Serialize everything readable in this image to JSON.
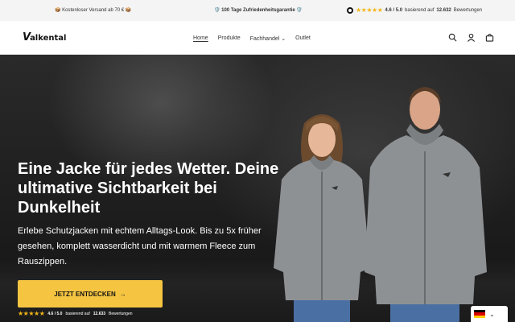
{
  "announcement": {
    "shipping": "📦 Kostenloser Versand ab 70 € 📦",
    "guarantee": "🛡️ 100 Tage Zufriedenheitsgarantie 🛡️",
    "rating_value": "4.6 / 5.0",
    "rating_text": "basierend auf",
    "rating_count": "12.632",
    "rating_suffix": "Bewertungen",
    "stars": "★★★★★"
  },
  "header": {
    "logo": "alkental",
    "logo_v": "V",
    "nav": [
      "Home",
      "Produkte",
      "Fachhandel ⌄",
      "Outlet"
    ],
    "icons": [
      "search-icon",
      "account-icon",
      "cart-icon"
    ]
  },
  "hero": {
    "headline": "Eine Jacke für jedes Wetter. Deine ultimative Sichtbarkeit bei Dunkelheit",
    "subtext": "Erlebe Schutzjacken mit echtem Alltags-Look. Bis zu 5x früher gesehen, komplett wasserdicht und mit warmem Fleece zum Rauszippen.",
    "cta_label": "JETZT ENTDECKEN",
    "cta_arrow": "→",
    "rating_stars": "★★★★★",
    "rating_value": "4.6 / 5.0",
    "rating_text": "basierend auf",
    "rating_count": "12.633",
    "rating_suffix": "Bewertungen"
  },
  "language": {
    "selected": "DE",
    "chevron": "⌄"
  },
  "colors": {
    "accent": "#f5c542",
    "star": "#f3b617",
    "jacket": "#8e9194"
  }
}
